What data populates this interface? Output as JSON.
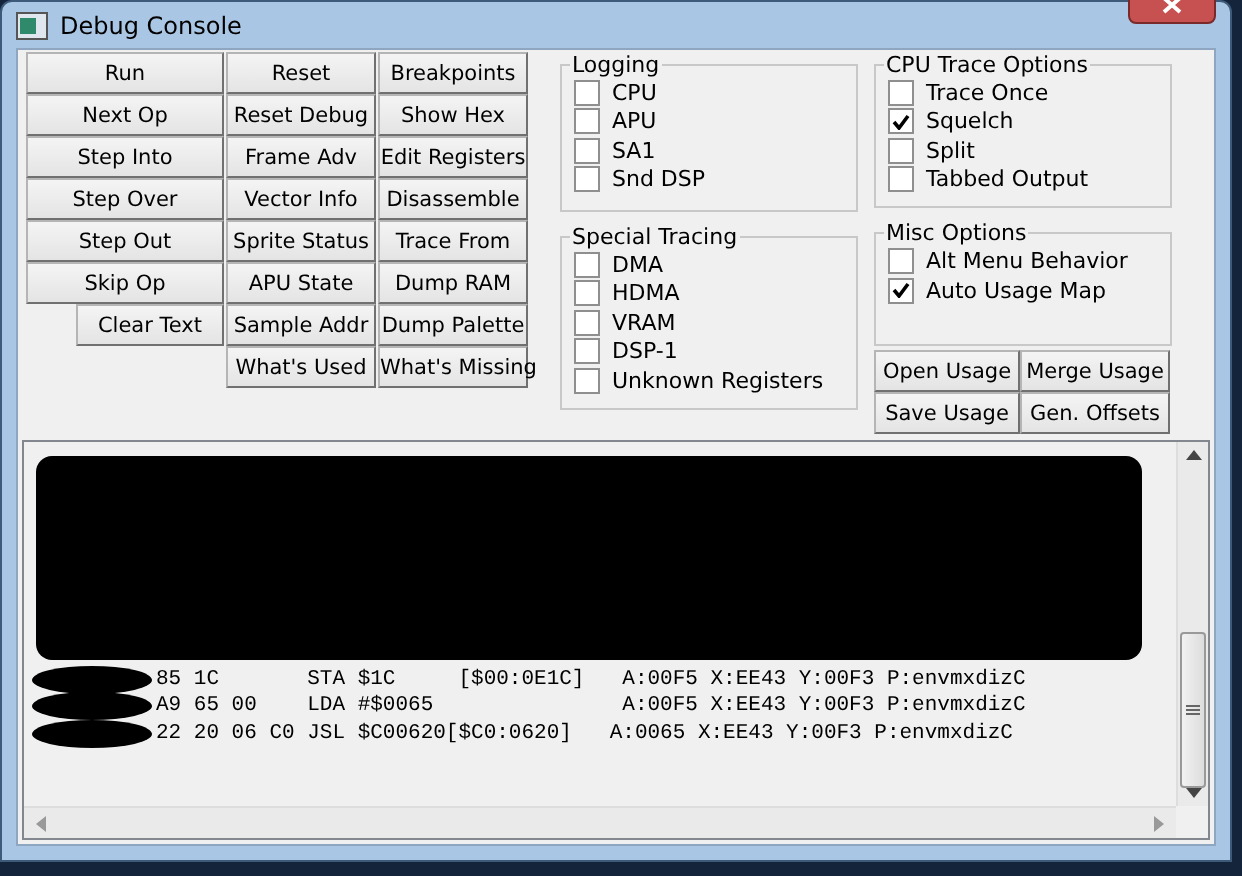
{
  "window": {
    "title": "Debug Console"
  },
  "button_columns": [
    [
      {
        "label": "Run",
        "kind": "full"
      },
      {
        "label": "Next Op",
        "kind": "full"
      },
      {
        "label": "Step Into",
        "kind": "full"
      },
      {
        "label": "Step Over",
        "kind": "full"
      },
      {
        "label": "Step Out",
        "kind": "full"
      },
      {
        "label": "Skip Op",
        "kind": "full"
      },
      {
        "label": "Clear Text",
        "kind": "short"
      }
    ],
    [
      {
        "label": "Reset",
        "kind": "full"
      },
      {
        "label": "Reset Debug",
        "kind": "full"
      },
      {
        "label": "Frame Adv",
        "kind": "full"
      },
      {
        "label": "Vector Info",
        "kind": "full"
      },
      {
        "label": "Sprite Status",
        "kind": "full"
      },
      {
        "label": "APU State",
        "kind": "full"
      },
      {
        "label": "Sample Addr",
        "kind": "full"
      },
      {
        "label": "What's Used",
        "kind": "full"
      }
    ],
    [
      {
        "label": "Breakpoints",
        "kind": "full"
      },
      {
        "label": "Show Hex",
        "kind": "full"
      },
      {
        "label": "Edit Registers",
        "kind": "full"
      },
      {
        "label": "Disassemble",
        "kind": "full"
      },
      {
        "label": "Trace From",
        "kind": "full"
      },
      {
        "label": "Dump RAM",
        "kind": "full"
      },
      {
        "label": "Dump Palette",
        "kind": "full"
      },
      {
        "label": "What's Missing",
        "kind": "full"
      }
    ]
  ],
  "option_columns": [
    [
      {
        "title": "Logging",
        "items": [
          {
            "label": "CPU",
            "checked": false
          },
          {
            "label": "APU",
            "checked": false
          },
          {
            "label": "SA1",
            "checked": false
          },
          {
            "label": "Snd DSP",
            "checked": false
          }
        ]
      },
      {
        "title": "Special Tracing",
        "items": [
          {
            "label": "DMA",
            "checked": false
          },
          {
            "label": "HDMA",
            "checked": false
          },
          {
            "label": "VRAM",
            "checked": false
          },
          {
            "label": "DSP-1",
            "checked": false
          },
          {
            "label": "Unknown Registers",
            "checked": false
          }
        ]
      }
    ],
    [
      {
        "title": "CPU Trace Options",
        "items": [
          {
            "label": "Trace Once",
            "checked": false
          },
          {
            "label": "Squelch",
            "checked": true
          },
          {
            "label": "Split",
            "checked": false
          },
          {
            "label": "Tabbed Output",
            "checked": false
          }
        ]
      },
      {
        "title": "Misc Options",
        "items": [
          {
            "label": "Alt Menu Behavior",
            "checked": false
          },
          {
            "label": "Auto Usage Map",
            "checked": true
          }
        ]
      }
    ]
  ],
  "usage_buttons": [
    "Open Usage",
    "Merge Usage",
    "Save Usage",
    "Gen. Offsets"
  ],
  "trace_lines": [
    "85 1C       STA $1C     [$00:0E1C]   A:00F5 X:EE43 Y:00F3 P:envmxdizC",
    "A9 65 00    LDA #$0065               A:00F5 X:EE43 Y:00F3 P:envmxdizC",
    "22 20 06 C0 JSL $C00620[$C0:0620]   A:0065 X:EE43 Y:00F3 P:envmxdizC"
  ]
}
